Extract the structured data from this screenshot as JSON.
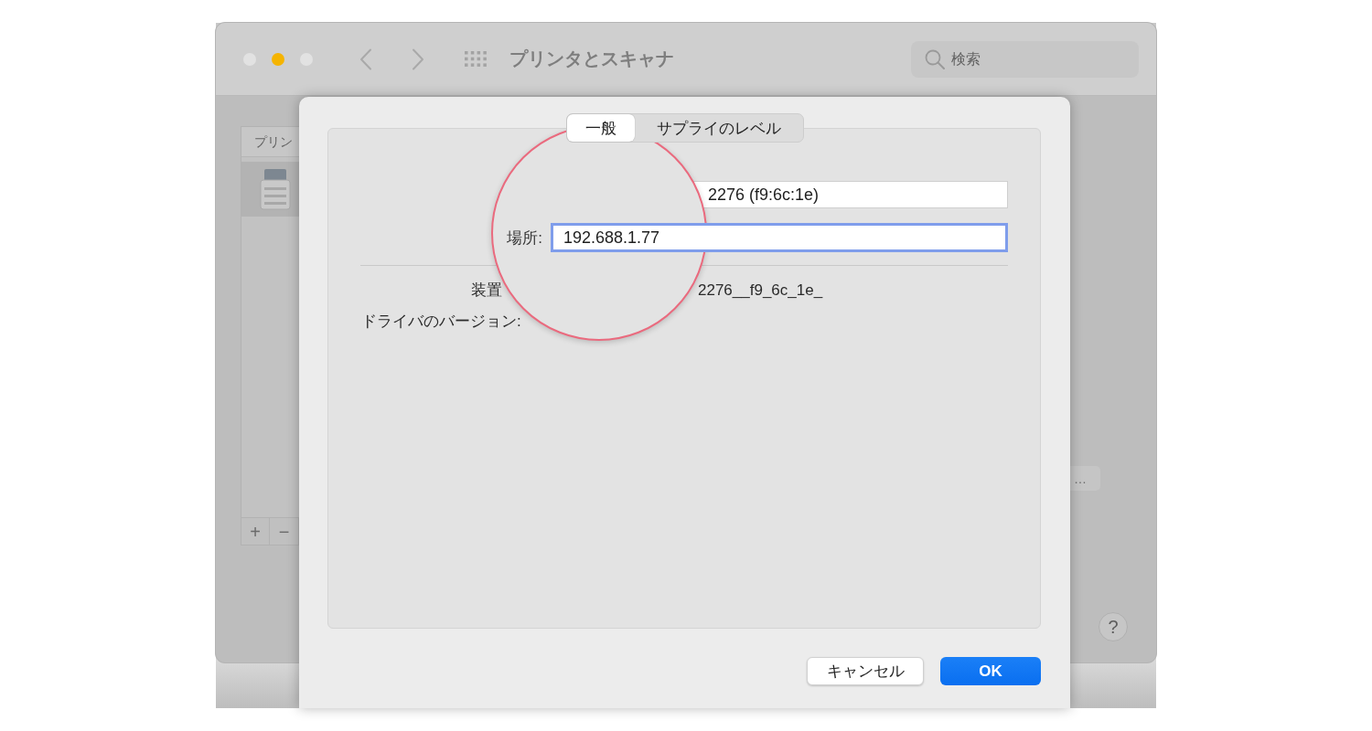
{
  "window": {
    "title": "プリンタとスキャナ",
    "search": {
      "placeholder": "検索"
    }
  },
  "printer_list": {
    "header": "プリン",
    "items": [
      {
        "selected": true
      }
    ],
    "buttons": [
      "+",
      "−"
    ]
  },
  "side_buttons": {
    "options": "…",
    "help": "?"
  },
  "dialog": {
    "tabs": [
      {
        "label": "一般",
        "selected": true
      },
      {
        "label": "サプライのレベル",
        "selected": false
      }
    ],
    "fields": [
      {
        "kind": "plain",
        "value": "2276 (f9:6c:1e)",
        "focused": false
      },
      {
        "kind": "labeled",
        "label": "場所:",
        "value": "192.688.1.77",
        "focused": true
      }
    ],
    "details": [
      {
        "kind": "pair",
        "label": "装置",
        "value": "2276__f9_6c_1e_"
      },
      {
        "kind": "label",
        "label": "ドライバのバージョン:"
      }
    ],
    "buttons": [
      {
        "label": "キャンセル",
        "kind": "secondary"
      },
      {
        "label": "OK",
        "kind": "default"
      }
    ]
  }
}
